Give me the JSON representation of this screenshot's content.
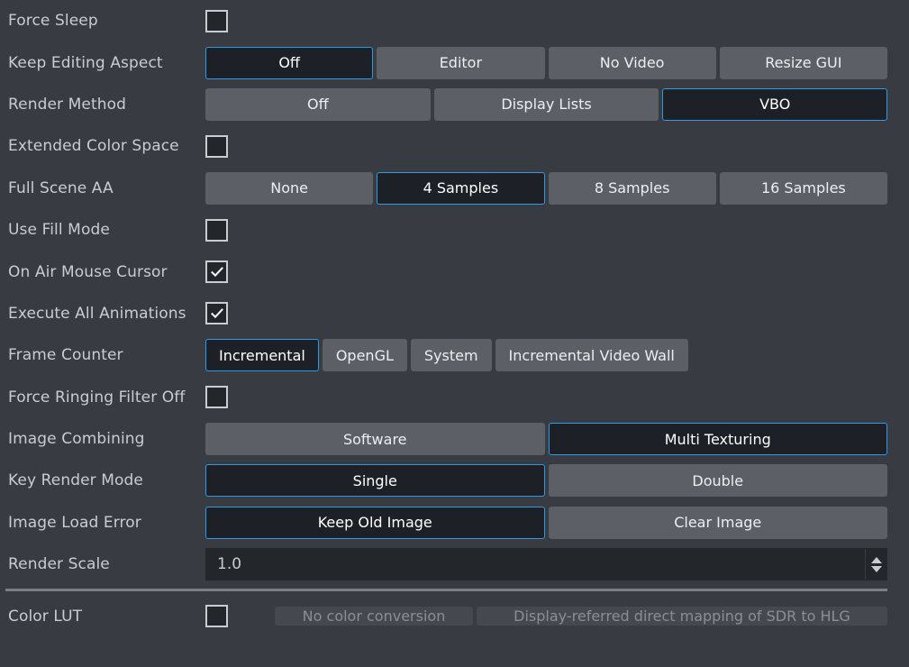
{
  "panel": {
    "rows": [
      {
        "label": "Force Sleep",
        "type": "checkbox",
        "checked": false
      },
      {
        "label": "Keep Editing Aspect",
        "type": "segmented",
        "sizing": "equal",
        "options": [
          "Off",
          "Editor",
          "No Video",
          "Resize GUI"
        ],
        "selected": 0
      },
      {
        "label": "Render Method",
        "type": "segmented",
        "sizing": "equal",
        "options": [
          "Off",
          "Display Lists",
          "VBO"
        ],
        "selected": 2
      },
      {
        "label": "Extended Color Space",
        "type": "checkbox",
        "checked": false
      },
      {
        "label": "Full Scene AA",
        "type": "segmented",
        "sizing": "equal",
        "options": [
          "None",
          "4 Samples",
          "8 Samples",
          "16 Samples"
        ],
        "selected": 1
      },
      {
        "label": "Use Fill Mode",
        "type": "checkbox",
        "checked": false
      },
      {
        "label": "On Air Mouse Cursor",
        "type": "checkbox",
        "checked": true
      },
      {
        "label": "Execute All Animations",
        "type": "checkbox",
        "checked": true
      },
      {
        "label": "Frame Counter",
        "type": "segmented",
        "sizing": "auto",
        "options": [
          "Incremental",
          "OpenGL",
          "System",
          "Incremental Video Wall"
        ],
        "selected": 0
      },
      {
        "label": "Force Ringing Filter Off",
        "type": "checkbox",
        "checked": false
      },
      {
        "label": "Image Combining",
        "type": "segmented",
        "sizing": "equal",
        "options": [
          "Software",
          "Multi Texturing"
        ],
        "selected": 1
      },
      {
        "label": "Key Render Mode",
        "type": "segmented",
        "sizing": "equal",
        "options": [
          "Single",
          "Double"
        ],
        "selected": 0
      },
      {
        "label": "Image Load Error",
        "type": "segmented",
        "sizing": "equal",
        "options": [
          "Keep Old Image",
          "Clear Image"
        ],
        "selected": 0
      },
      {
        "label": "Render Scale",
        "type": "spinbox",
        "value": "1.0"
      },
      {
        "type": "divider"
      },
      {
        "label": "Color LUT",
        "type": "lut",
        "checked": false,
        "options": [
          "No color conversion",
          "Display-referred direct mapping of SDR to HLG"
        ],
        "disabled": true
      }
    ]
  },
  "colors": {
    "background": "#383c42",
    "button": "#5c6066",
    "selected_bg": "#1d2127",
    "accent": "#2b9ae8",
    "label_text": "#c9cdd1",
    "disabled_text": "#8a8f95",
    "divider": "#7a7f86"
  },
  "icons": {
    "check": "checkmark-icon",
    "spin_up": "spinner-up-arrow-icon",
    "spin_down": "spinner-down-arrow-icon"
  }
}
